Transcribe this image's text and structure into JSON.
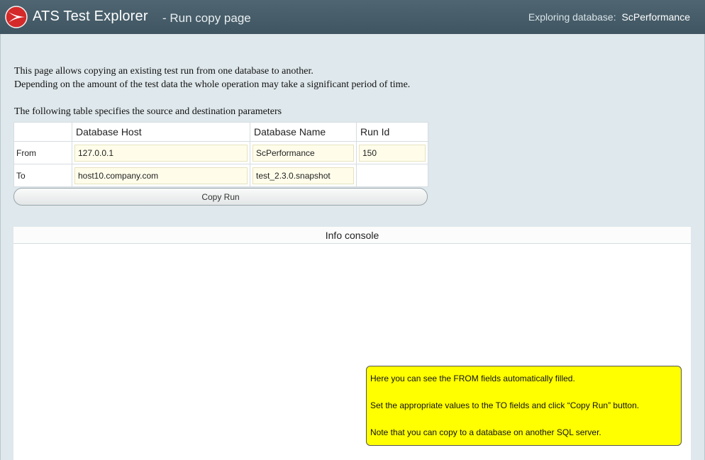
{
  "header": {
    "app_title": "ATS Test Explorer",
    "page_subtitle": "- Run copy page",
    "db_label": "Exploring database:",
    "db_name": "ScPerformance",
    "logo_icon": "ats-logo-icon",
    "colors": {
      "header_bg": "#455c68",
      "logo_red": "#d42a2a"
    }
  },
  "intro": {
    "line1": "This page allows copying an existing test run from one database to another.",
    "line2": "Depending on the amount of the test data the whole operation may take a significant period of time."
  },
  "table": {
    "caption": "The following table specifies the source and destination parameters",
    "headers": [
      "",
      "Database Host",
      "Database Name",
      "Run Id"
    ],
    "rows": [
      {
        "label": "From",
        "host": "127.0.0.1",
        "name": "ScPerformance",
        "run_id": "150"
      },
      {
        "label": "To",
        "host": "host10.company.com",
        "name": "test_2.3.0.snapshot"
      }
    ]
  },
  "copy_button": {
    "label": "Copy Run"
  },
  "console": {
    "title": "Info console"
  },
  "tooltip": {
    "line1": "Here you can see the FROM fields automatically filled.",
    "line2": "Set the appropriate values to the TO fields and click “Copy Run” button.",
    "line3": "Note that you can copy to a database on another SQL server.",
    "color": "#ffff00"
  }
}
